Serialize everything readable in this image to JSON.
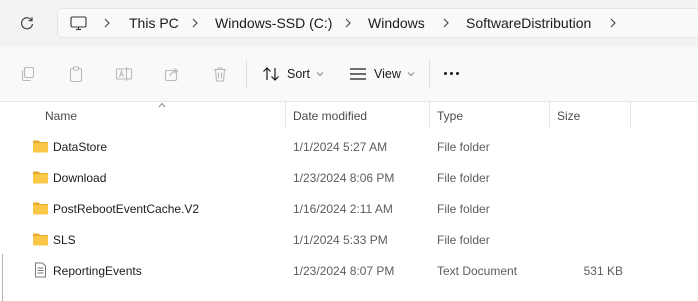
{
  "address_bar": {
    "crumbs": [
      "This PC",
      "Windows-SSD (C:)",
      "Windows",
      "SoftwareDistribution"
    ]
  },
  "toolbar": {
    "sort_label": "Sort",
    "view_label": "View"
  },
  "columns": {
    "name": "Name",
    "date": "Date modified",
    "type": "Type",
    "size": "Size"
  },
  "files": [
    {
      "name": "DataStore",
      "date": "1/1/2024 5:27 AM",
      "type": "File folder",
      "size": "",
      "icon": "folder-icon"
    },
    {
      "name": "Download",
      "date": "1/23/2024 8:06 PM",
      "type": "File folder",
      "size": "",
      "icon": "folder-icon"
    },
    {
      "name": "PostRebootEventCache.V2",
      "date": "1/16/2024 2:11 AM",
      "type": "File folder",
      "size": "",
      "icon": "folder-icon"
    },
    {
      "name": "SLS",
      "date": "1/1/2024 5:33 PM",
      "type": "File folder",
      "size": "",
      "icon": "folder-icon"
    },
    {
      "name": "ReportingEvents",
      "date": "1/23/2024 8:07 PM",
      "type": "Text Document",
      "size": "531 KB",
      "icon": "text-document-icon"
    }
  ],
  "colors": {
    "folder_yellow": "#f8c846",
    "folder_tab": "#e9a92c",
    "disabled_icon": "#b9b9b9"
  }
}
